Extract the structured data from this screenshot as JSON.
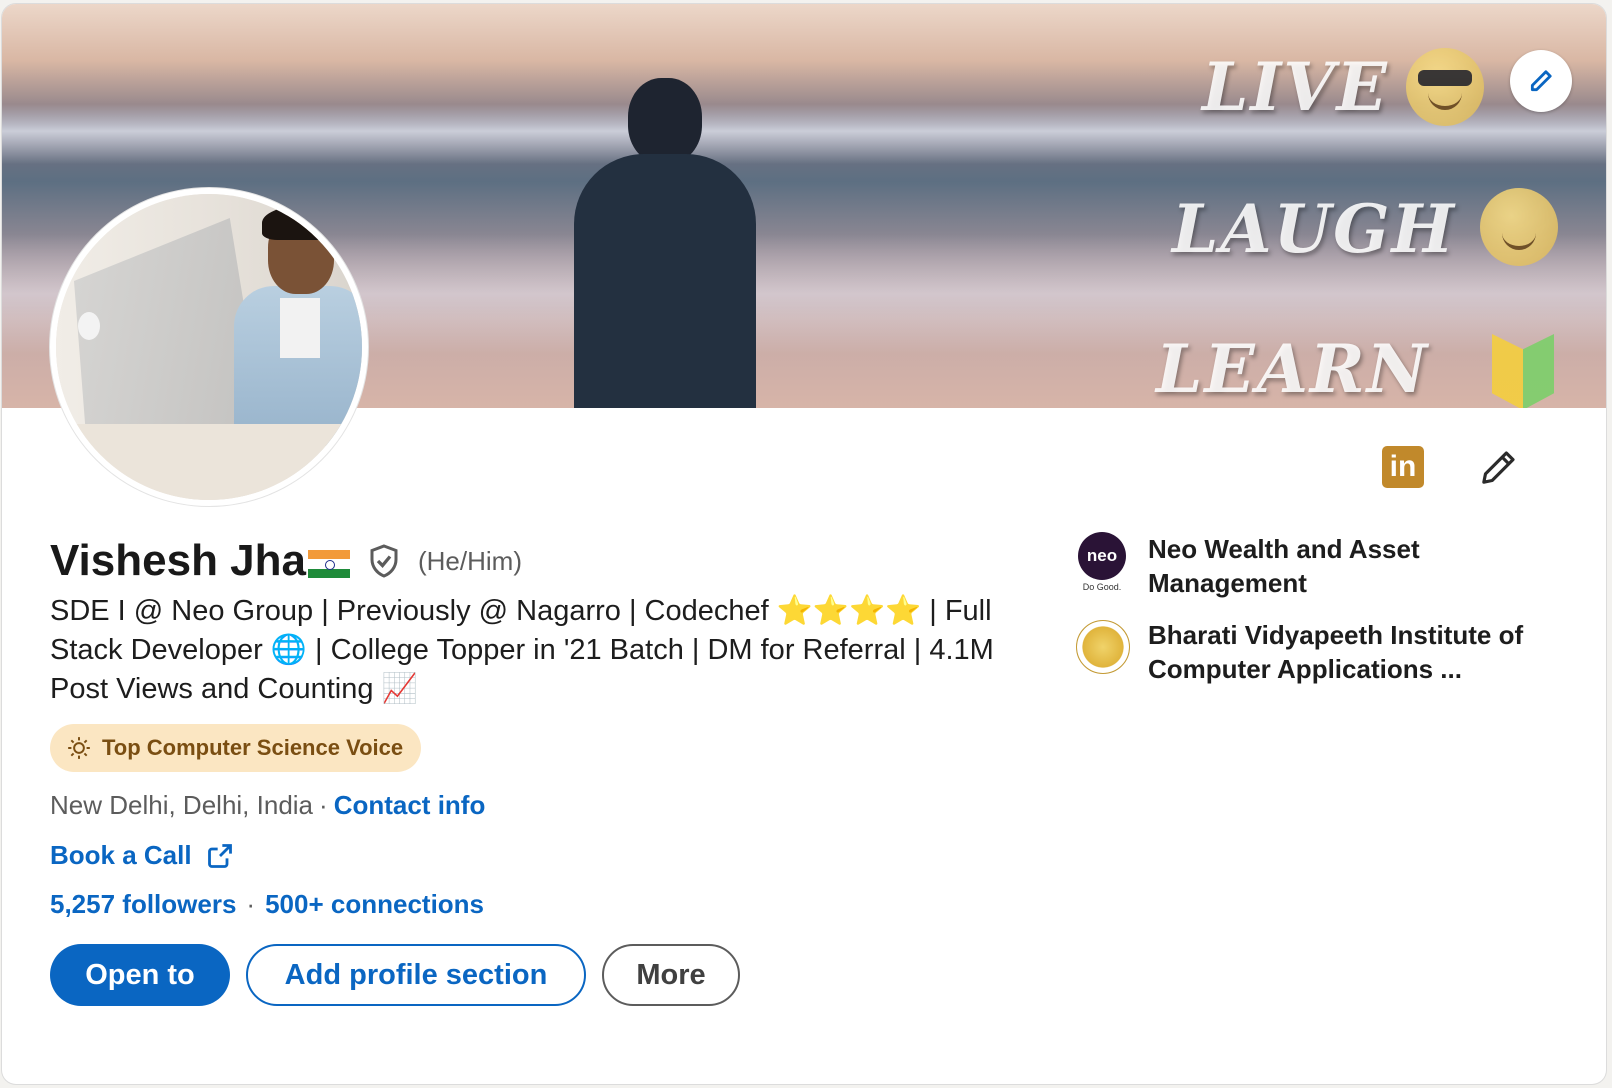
{
  "profile": {
    "name": "Vishesh Jha",
    "pronouns": "(He/Him)",
    "headline": "SDE I @ Neo Group | Previously @ Nagarro | Codechef ⭐⭐⭐⭐ | Full Stack Developer 🌐 | College Topper in '21 Batch | DM for Referral | 4.1M Post Views and Counting 📈",
    "badge": "Top Computer Science Voice",
    "location": "New Delhi, Delhi, India",
    "location_sep": "·",
    "contact_info": "Contact info",
    "book_call": "Book a Call",
    "followers": "5,257 followers",
    "connections_sep": "·",
    "connections": "500+ connections"
  },
  "banner": {
    "words": [
      "LIVE",
      "LAUGH",
      "LEARN"
    ]
  },
  "actions": {
    "open_to": "Open to",
    "add_section": "Add profile section",
    "more": "More"
  },
  "organizations": [
    {
      "name": "Neo Wealth and Asset Management",
      "logo_text": "neo",
      "logo_sub": "Do Good."
    },
    {
      "name": "Bharati Vidyapeeth Institute of Computer Applications ...",
      "logo_text": ""
    }
  ],
  "icons": {
    "linkedin_mark": "in"
  },
  "colors": {
    "accent": "#0a66c2",
    "badge_bg": "#fbe6c2",
    "badge_text": "#7a4e12",
    "linkedin_mark_bg": "#c1892b"
  }
}
